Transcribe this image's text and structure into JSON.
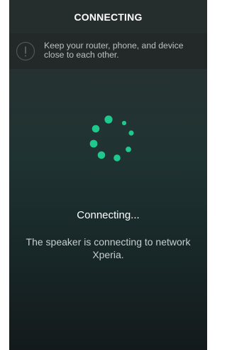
{
  "header": {
    "title": "CONNECTING"
  },
  "notice": {
    "icon": "info-icon",
    "text": "Keep your router, phone, and device close to each other."
  },
  "spinner": {
    "icon": "loading-spinner-icon",
    "accent": "#1fc88c"
  },
  "status": {
    "title": "Connecting...",
    "description": "The speaker is connecting to network Xperia."
  }
}
